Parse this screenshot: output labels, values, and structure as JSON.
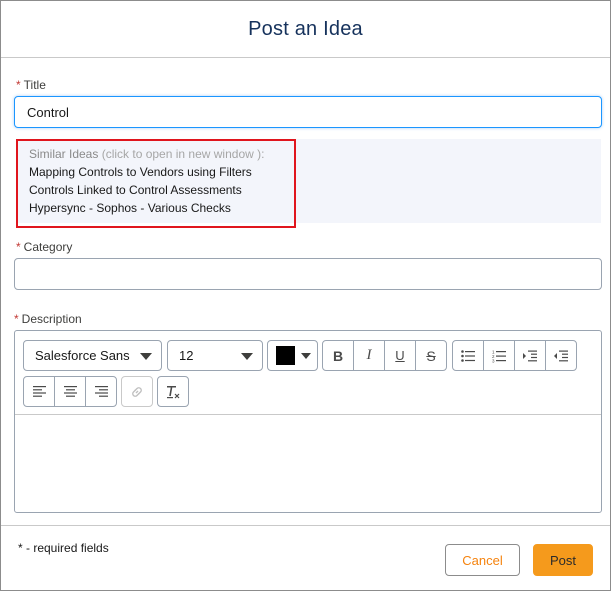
{
  "dialog": {
    "title": "Post an Idea"
  },
  "fields": {
    "required_mark": "*",
    "title_label": "Title",
    "title_value": "Control",
    "category_label": "Category",
    "category_value": "",
    "description_label": "Description"
  },
  "similar_ideas": {
    "heading": "Similar Ideas",
    "hint": "(click to open in new window ):",
    "items": [
      "Mapping Controls to Vendors using Filters",
      "Controls Linked to Control Assessments",
      "Hypersync - Sophos - Various Checks"
    ]
  },
  "editor": {
    "font_family_value": "Salesforce Sans",
    "font_size_value": "12",
    "text_color": "#000000",
    "bold_label": "B",
    "italic_label": "I",
    "underline_label": "U",
    "strike_label": "S",
    "icons": [
      "bold-icon",
      "italic-icon",
      "underline-icon",
      "strikethrough-icon",
      "bullet-list-icon",
      "numbered-list-icon",
      "indent-icon",
      "outdent-icon",
      "align-left-icon",
      "align-center-icon",
      "align-right-icon",
      "link-icon",
      "clear-formatting-icon"
    ],
    "body_value": ""
  },
  "footer": {
    "required_note": "* - required fields",
    "cancel_label": "Cancel",
    "post_label": "Post"
  },
  "colors": {
    "accent": "#f59a1c",
    "highlight_outline": "#e0151d",
    "required": "#c23934",
    "focus": "#1b96ff"
  }
}
